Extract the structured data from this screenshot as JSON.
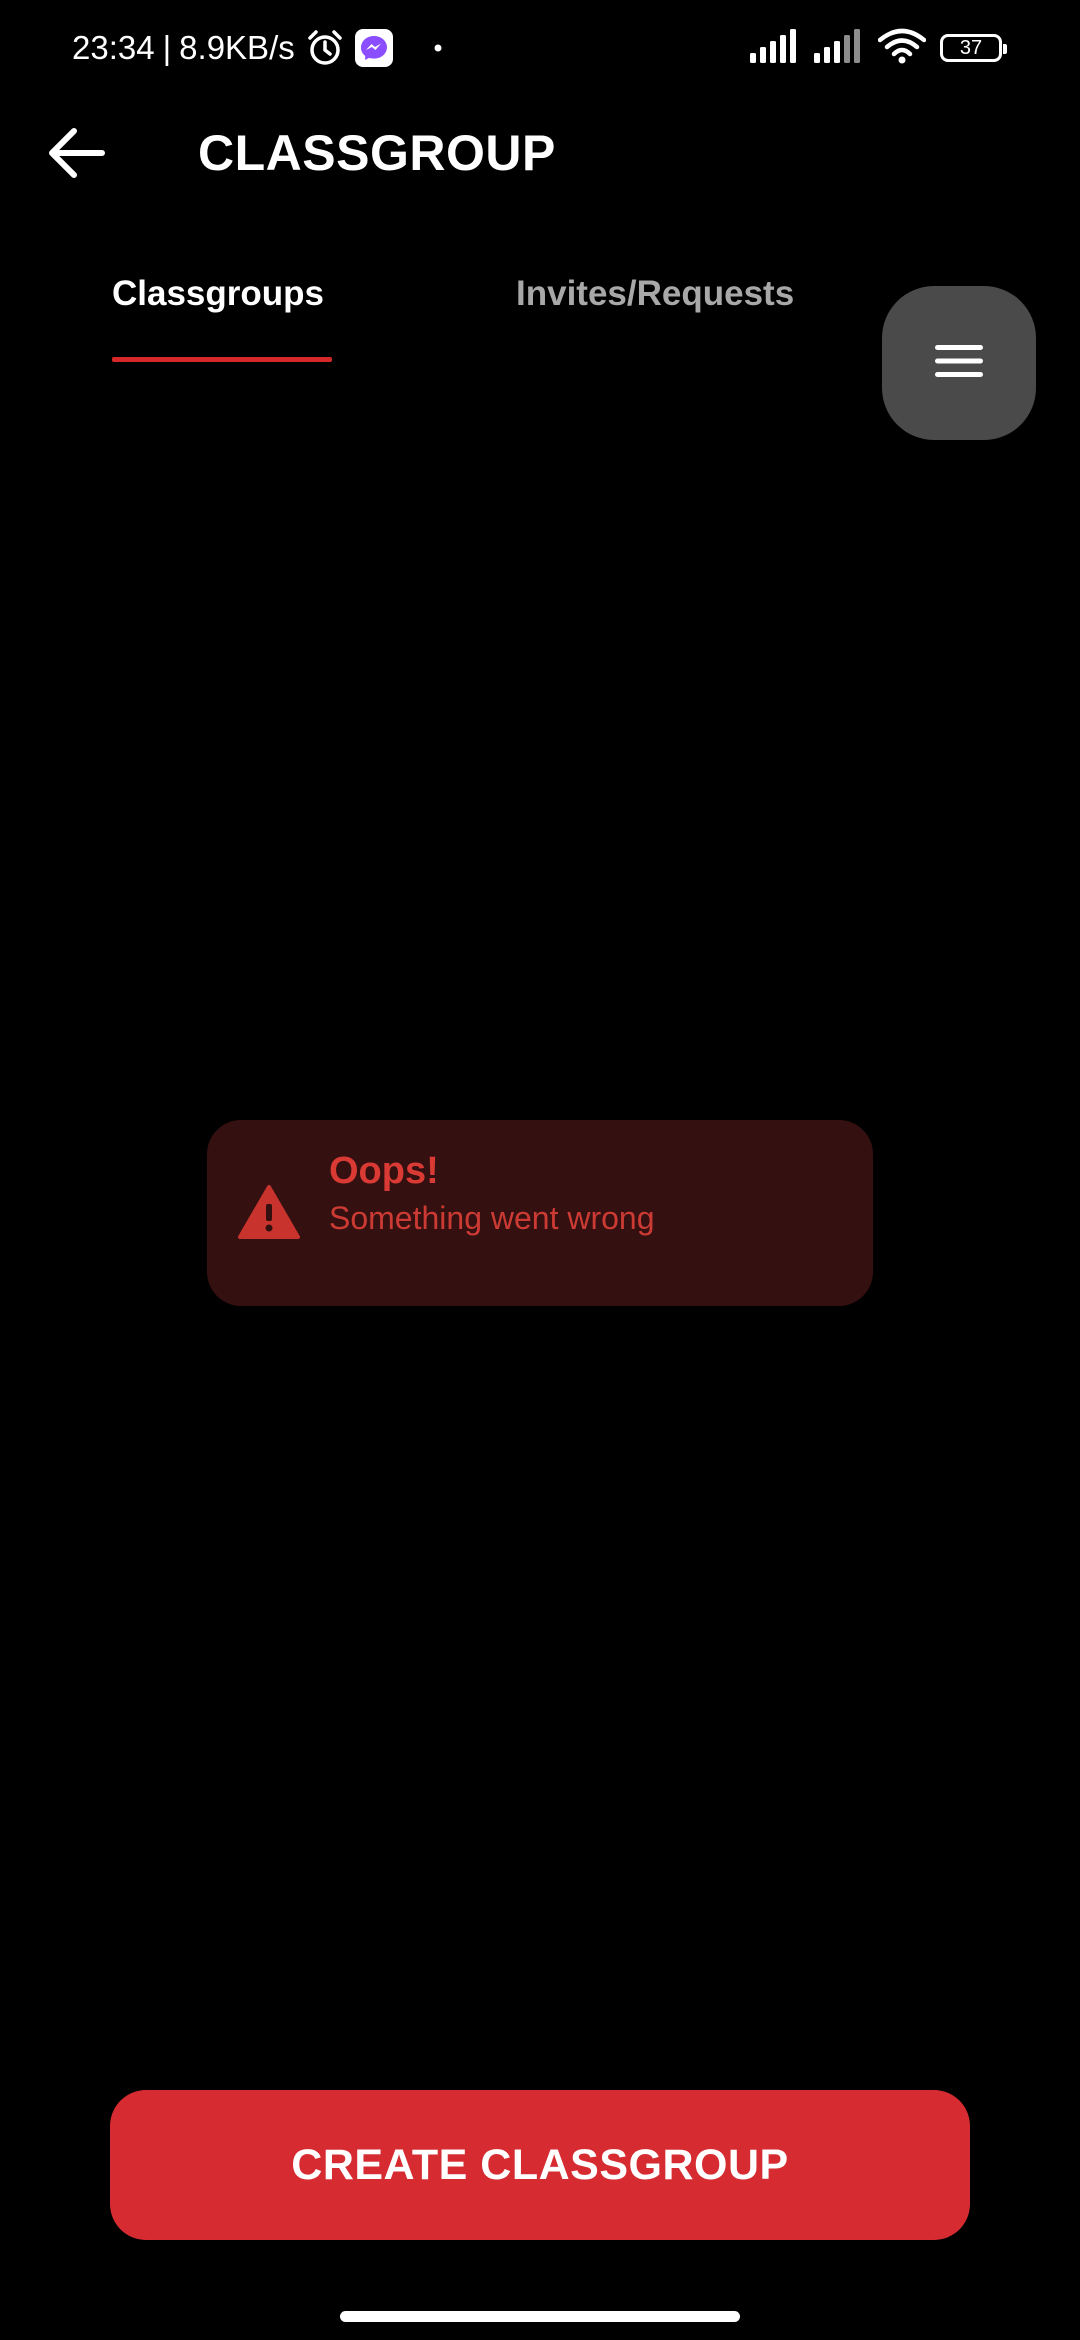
{
  "status_bar": {
    "time": "23:34",
    "separator": "|",
    "network_speed": "8.9KB/s",
    "left_icons": [
      "alarm-icon",
      "messenger-icon",
      "notification-dot-icon"
    ],
    "right_icons": [
      "signal-icon",
      "signal-icon",
      "wifi-icon",
      "battery-icon"
    ],
    "battery_level": "37"
  },
  "header": {
    "back_icon": "arrow-left-icon",
    "title": "CLASSGROUP"
  },
  "tabs": [
    {
      "label": "Classgroups",
      "active": true
    },
    {
      "label": "Invites/Requests",
      "active": false
    }
  ],
  "menu_button": {
    "icon": "hamburger-menu-icon"
  },
  "error": {
    "icon": "warning-triangle-icon",
    "title": "Oops!",
    "message": "Something went wrong"
  },
  "create_button": {
    "label": "CREATE CLASSGROUP"
  },
  "colors": {
    "background": "#000000",
    "accent": "#d62c31",
    "error_text": "#d93a34",
    "error_card_bg": "#341010",
    "inactive_tab": "#a8a8a8",
    "menu_button_bg": "#4a4a4a"
  }
}
